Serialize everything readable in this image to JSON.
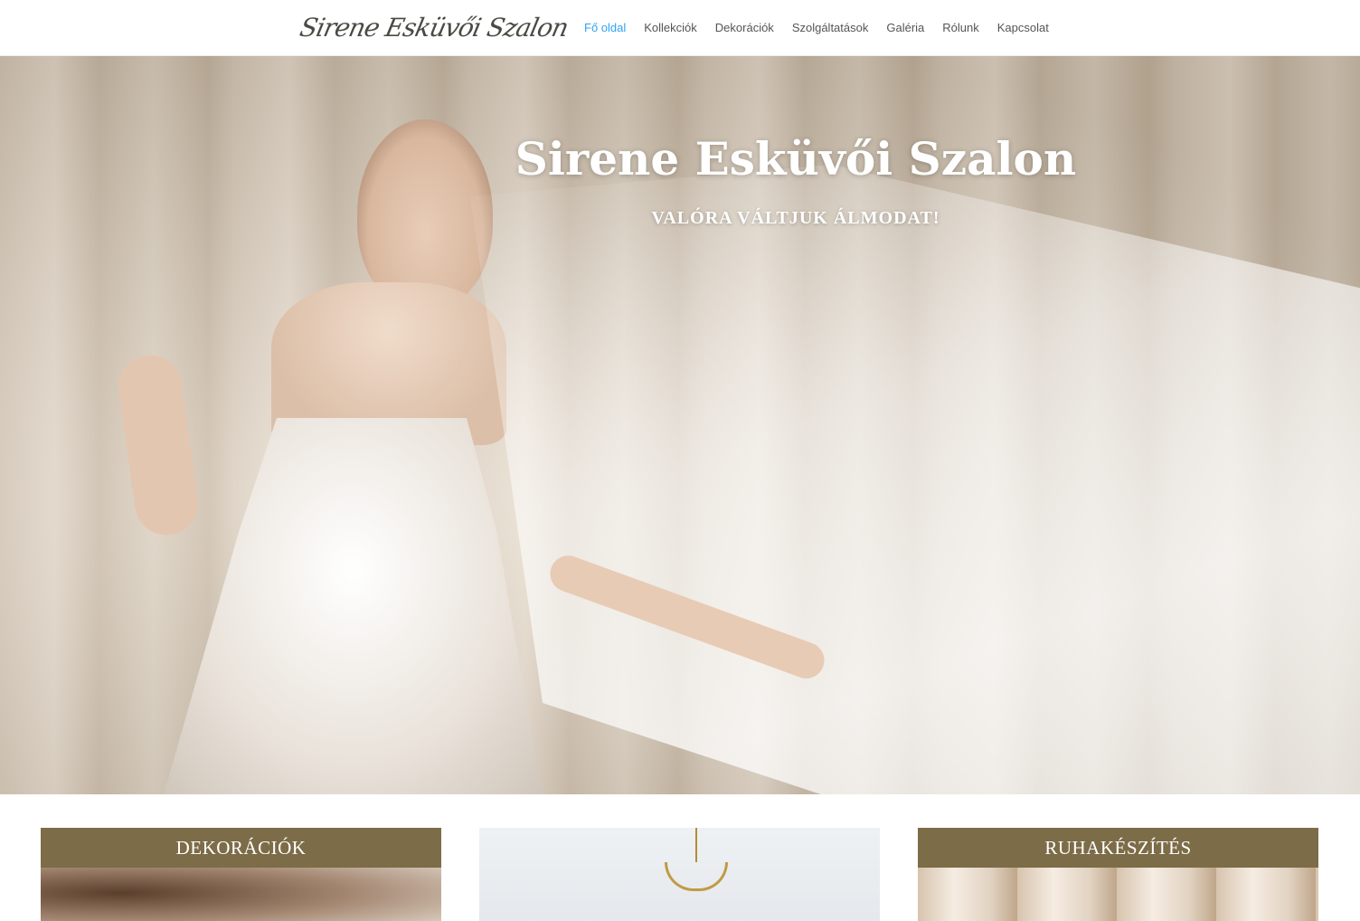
{
  "header": {
    "logo_text": "Sirene Esküvői Szalon",
    "nav": [
      {
        "label": "Fő oldal",
        "active": true
      },
      {
        "label": "Kollekciók",
        "active": false
      },
      {
        "label": "Dekorációk",
        "active": false
      },
      {
        "label": "Szolgáltatások",
        "active": false
      },
      {
        "label": "Galéria",
        "active": false
      },
      {
        "label": "Rólunk",
        "active": false
      },
      {
        "label": "Kapcsolat",
        "active": false
      }
    ]
  },
  "hero": {
    "title": "Sirene Esküvői Szalon",
    "subtitle": "VALÓRA VÁLTJUK ÁLMODAT!"
  },
  "cards": [
    {
      "title": "DEKORÁCIÓK"
    },
    {
      "title": ""
    },
    {
      "title": "RUHAKÉSZÍTÉS"
    }
  ],
  "colors": {
    "accent": "#2ea3f2",
    "card_header": "#7c6c47",
    "nav_text": "#555555"
  }
}
